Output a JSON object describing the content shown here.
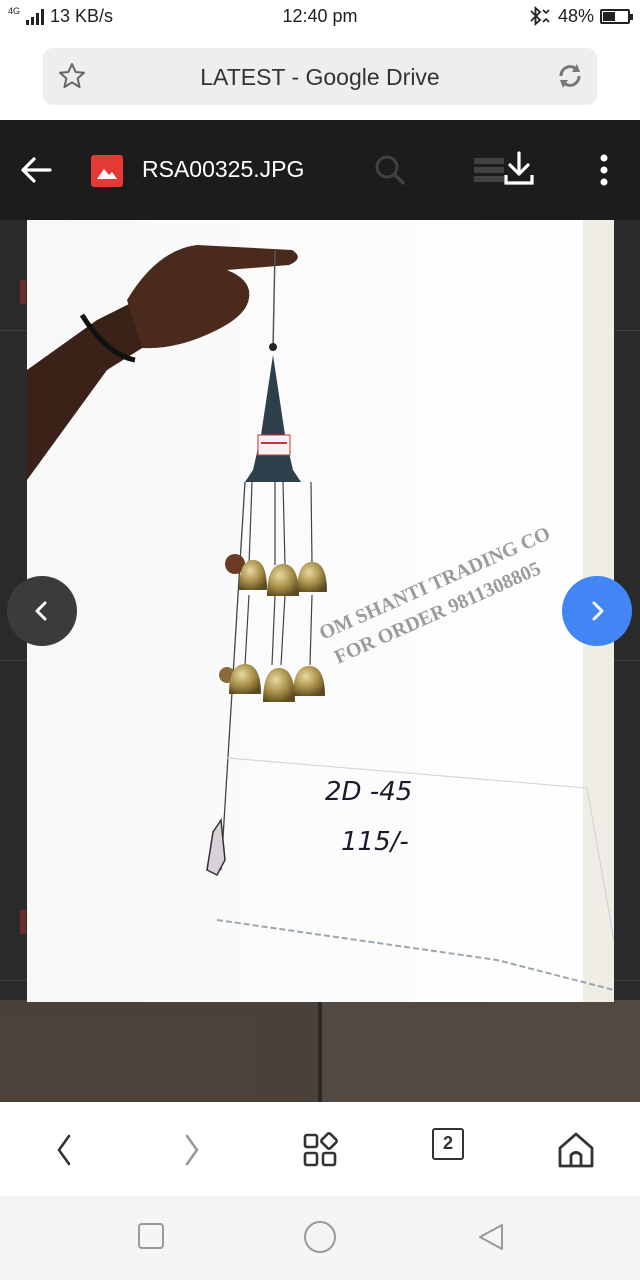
{
  "status_bar": {
    "network_type": "4G",
    "data_speed": "13 KB/s",
    "time": "12:40 pm",
    "battery": "48%",
    "battery_level": 0.48
  },
  "browser": {
    "page_title": "LATEST - Google Drive",
    "tab_count": "2"
  },
  "drive_viewer": {
    "file_name": "RSA00325.JPG"
  },
  "photo": {
    "watermark_line1": "OM SHANTI TRADING CO",
    "watermark_line2": "FOR ORDER 9811308805",
    "handwritten_code": "2D -45",
    "handwritten_price": "115/-"
  },
  "colors": {
    "next_button": "#4285f4",
    "file_icon": "#e53935",
    "topbar": "#1c1c1c"
  }
}
